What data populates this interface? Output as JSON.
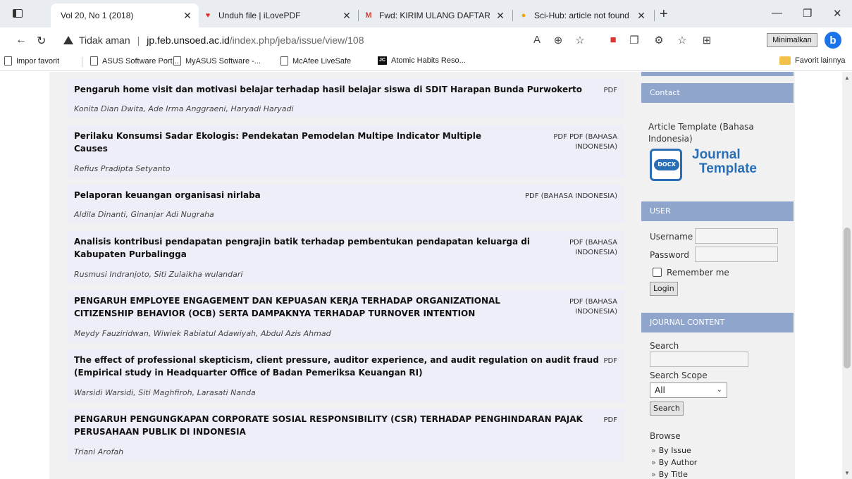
{
  "tabs": [
    {
      "title": "Vol 20, No 1 (2018)",
      "favicon": "page-icon",
      "active": true
    },
    {
      "title": "Unduh file | iLovePDF",
      "favicon": "heart-icon",
      "active": false,
      "color": "#e5322d"
    },
    {
      "title": "Fwd: KIRIM ULANG DAFTAR HAS",
      "favicon": "gmail-icon",
      "active": false,
      "color": "#d44638"
    },
    {
      "title": "Sci-Hub: article not found",
      "favicon": "scihub-icon",
      "active": false,
      "color": "#f0a500"
    }
  ],
  "toolbar": {
    "security_label": "Tidak aman",
    "url_host": "jp.feb.unsoed.ac.id",
    "url_path": "/index.php/jeba/issue/view/108",
    "tooltip": "Minimalkan"
  },
  "bookmarks": [
    {
      "label": "Impor favorit",
      "icon": "import-icon"
    },
    {
      "label": "ASUS Software Port...",
      "icon": "page-icon"
    },
    {
      "label": "MyASUS Software -...",
      "icon": "page-icon"
    },
    {
      "label": "McAfee LiveSafe",
      "icon": "page-icon"
    },
    {
      "label": "Atomic Habits Reso...",
      "icon": "jc-icon"
    }
  ],
  "bookmarks_other": "Favorit lainnya",
  "articles": [
    {
      "title_lines": [
        "Pengaruh home visit dan motivasi belajar terhadap hasil belajar siswa di SDIT Harapan Bunda Purwokerto"
      ],
      "galleys": [
        "PDF"
      ],
      "authors": "Konita Dian Dwita, Ade Irma Anggraeni, Haryadi Haryadi"
    },
    {
      "title_lines": [
        "Perilaku Konsumsi Sadar Ekologis: Pendekatan Pemodelan Multipe Indicator Multiple",
        "Causes"
      ],
      "galleys": [
        "PDF PDF (BAHASA",
        "INDONESIA)"
      ],
      "authors": "Refius Pradipta Setyanto"
    },
    {
      "title_lines": [
        "Pelaporan keuangan organisasi nirlaba"
      ],
      "galleys": [
        "PDF (BAHASA INDONESIA)"
      ],
      "authors": "Aldila Dinanti, Ginanjar Adi Nugraha"
    },
    {
      "title_lines": [
        "Analisis kontribusi pendapatan pengrajin batik terhadap pembentukan pendapatan keluarga di",
        "Kabupaten Purbalingga"
      ],
      "galleys": [
        "PDF (BAHASA",
        "INDONESIA)"
      ],
      "authors": "Rusmusi Indranjoto, Siti Zulaikha wulandari"
    },
    {
      "title_lines": [
        "PENGARUH EMPLOYEE ENGAGEMENT DAN KEPUASAN KERJA TERHADAP ORGANIZATIONAL",
        "CITIZENSHIP BEHAVIOR (OCB) SERTA DAMPAKNYA TERHADAP TURNOVER INTENTION"
      ],
      "galleys": [
        "PDF (BAHASA",
        "INDONESIA)"
      ],
      "authors": "Meydy Fauziridwan, Wiwiek Rabiatul Adawiyah, Abdul Azis Ahmad"
    },
    {
      "title_lines": [
        "The effect of professional skepticism, client pressure, auditor experience, and audit regulation on audit fraud",
        "(Empirical study in Headquarter Office of Badan Pemeriksa Keuangan RI)"
      ],
      "galleys": [
        "PDF"
      ],
      "authors": "Warsidi Warsidi, Siti Maghfiroh, Larasati Nanda"
    },
    {
      "title_lines": [
        "PENGARUH PENGUNGKAPAN CORPORATE SOSIAL RESPONSIBILITY (CSR) TERHADAP PENGHINDARAN PAJAK",
        "PERUSAHAAN PUBLIK DI INDONESIA"
      ],
      "galleys": [
        "PDF"
      ],
      "authors": "Triani Arofah"
    }
  ],
  "sidebar": {
    "contact_heading": "Contact",
    "template_text_1": "Article Template (Bahasa",
    "template_text_2": "Indonesia)",
    "template_badge": "DOCX",
    "template_word_1": "Journal",
    "template_word_2": "Template",
    "user_heading": "USER",
    "username_label": "Username",
    "password_label": "Password",
    "remember_label": "Remember me",
    "login_button": "Login",
    "journal_content_heading": "JOURNAL CONTENT",
    "search_label": "Search",
    "search_scope_label": "Search Scope",
    "scope_value": "All",
    "search_button": "Search",
    "browse_label": "Browse",
    "browse_links": [
      "By Issue",
      "By Author",
      "By Title"
    ]
  },
  "colors": {
    "sidebar_heading": "#8fa5cc",
    "article_bg": "#eeeef8",
    "page_bg": "#f1f1f1",
    "docx_blue": "#2a6fb5"
  }
}
